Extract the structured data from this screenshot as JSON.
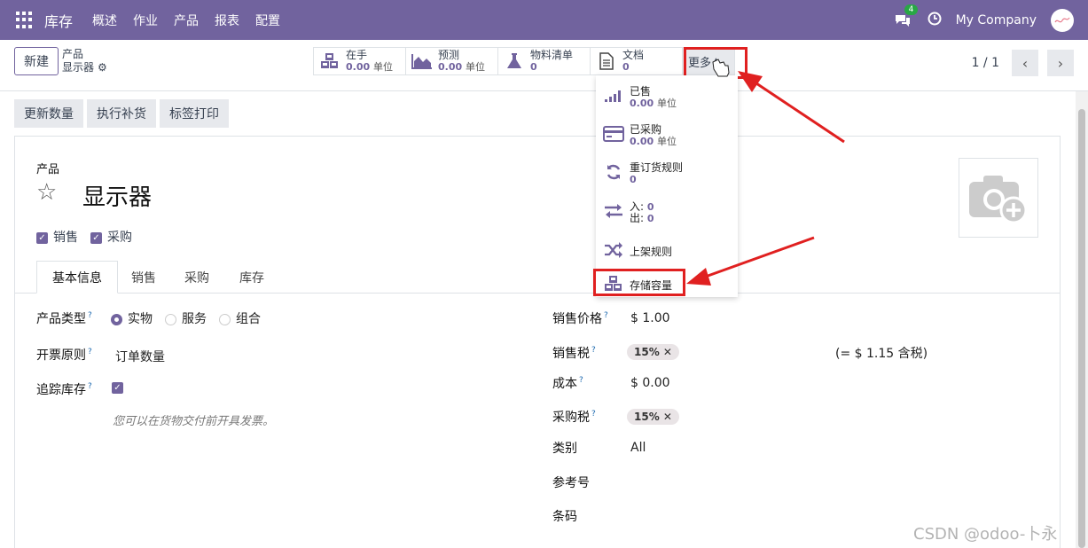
{
  "navbar": {
    "app_name": "库存",
    "menu": [
      "概述",
      "作业",
      "产品",
      "报表",
      "配置"
    ],
    "messages_count": "4",
    "company": "My Company"
  },
  "control": {
    "new_label": "新建",
    "breadcrumb_parent": "产品",
    "breadcrumb_current": "显示器",
    "smart_buttons": [
      {
        "title": "在手",
        "value": "0.00",
        "unit": "单位",
        "icon": "cubes-icon"
      },
      {
        "title": "预测",
        "value": "0.00",
        "unit": "单位",
        "icon": "area-chart-icon"
      },
      {
        "title": "物料清单",
        "value": "0",
        "unit": "",
        "icon": "flask-icon"
      },
      {
        "title": "文档",
        "value": "0",
        "unit": "",
        "icon": "file-icon"
      }
    ],
    "more_label": "更多",
    "pager": "1 / 1"
  },
  "actions": [
    "更新数量",
    "执行补货",
    "标签打印"
  ],
  "dropdown": [
    {
      "title": "已售",
      "value": "0.00",
      "unit": "单位",
      "icon": "signal-icon"
    },
    {
      "title": "已采购",
      "value": "0.00",
      "unit": "单位",
      "icon": "credit-card-icon"
    },
    {
      "title": "重订货规则",
      "value": "0",
      "unit": "",
      "icon": "refresh-icon"
    },
    {
      "in_label": "入:",
      "in_value": "0",
      "out_label": "出:",
      "out_value": "0",
      "icon": "exchange-icon"
    },
    {
      "title": "上架规则",
      "icon": "random-icon"
    },
    {
      "title": "存储容量",
      "icon": "cubes-icon"
    }
  ],
  "product": {
    "caption": "产品",
    "name": "显示器",
    "can_sell": "销售",
    "can_buy": "采购",
    "tabs": [
      "基本信息",
      "销售",
      "采购",
      "库存"
    ],
    "type_label": "产品类型",
    "type_options": [
      "实物",
      "服务",
      "组合"
    ],
    "invoice_label": "开票原则",
    "invoice_value": "订单数量",
    "track_label": "追踪库存",
    "hint": "您可以在货物交付前开具发票。",
    "sale_price_label": "销售价格",
    "sale_price": "$ 1.00",
    "sale_tax_label": "销售税",
    "sale_tax": "15%",
    "tax_included": "(= $ 1.15 含税)",
    "cost_label": "成本",
    "cost": "$ 0.00",
    "purchase_tax_label": "采购税",
    "purchase_tax": "15%",
    "category_label": "类别",
    "category": "All",
    "reference_label": "参考号",
    "barcode_label": "条码"
  },
  "watermark": "CSDN @odoo-卜永"
}
